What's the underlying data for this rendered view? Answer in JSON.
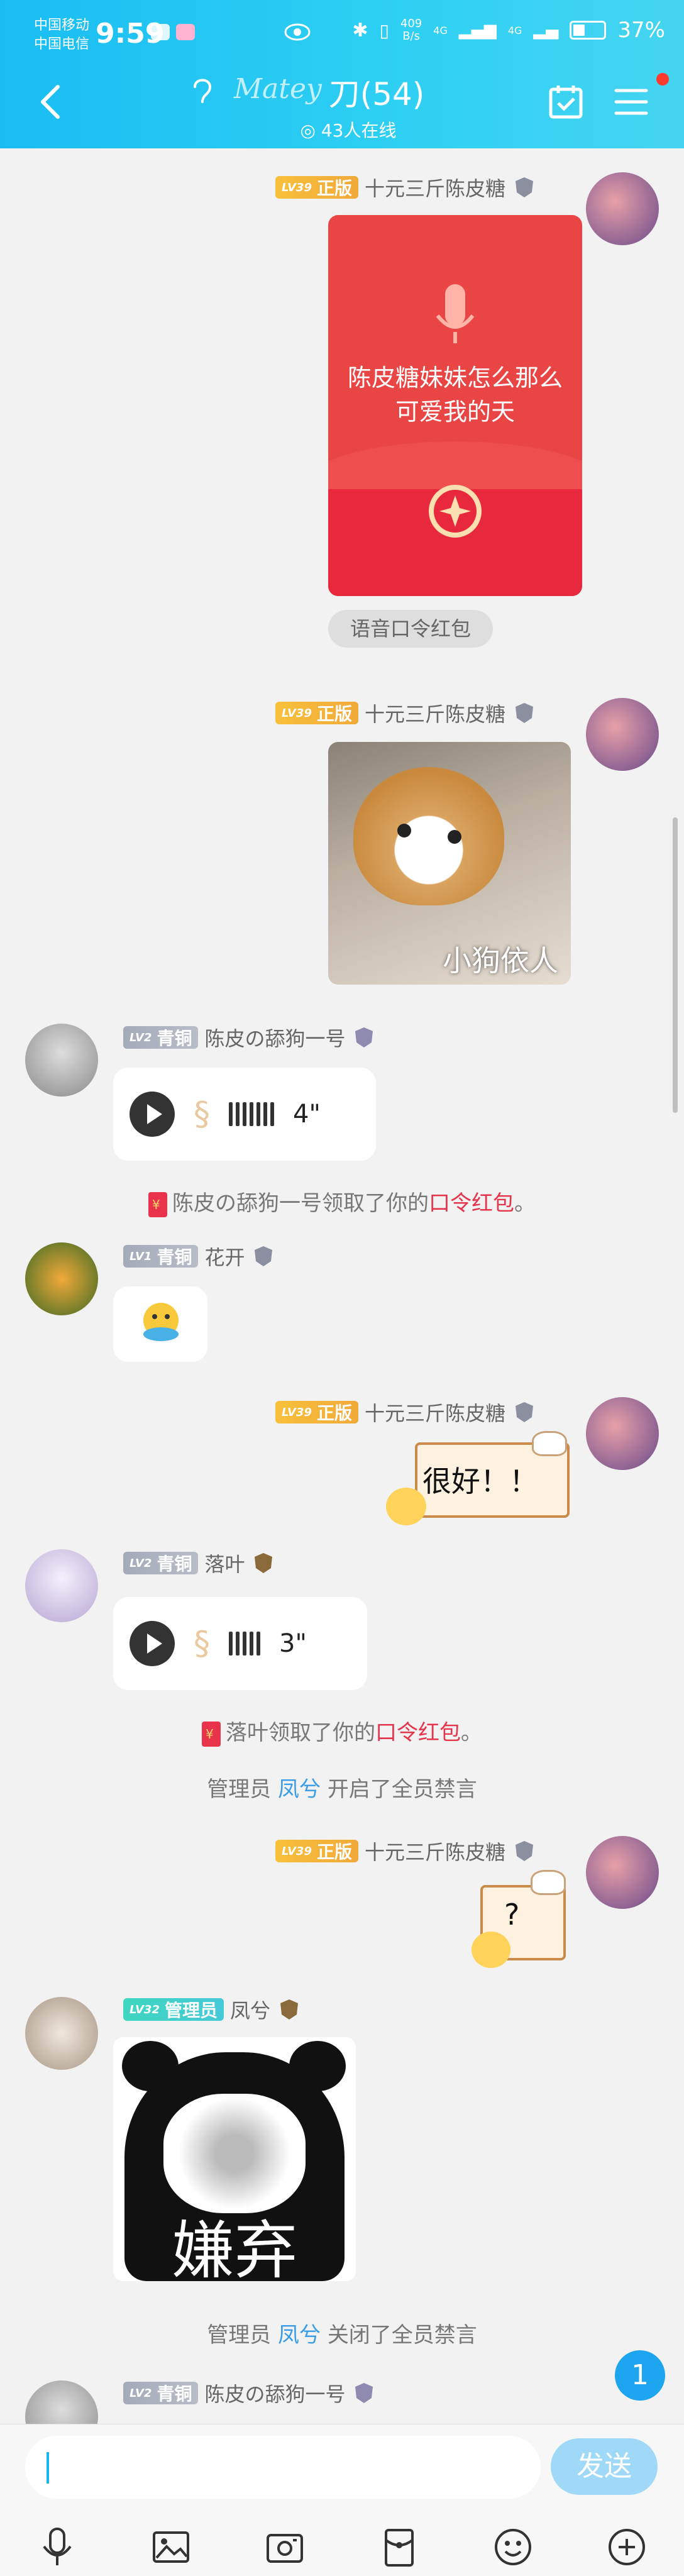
{
  "status_bar": {
    "carrier_1": "中国移动",
    "carrier_2": "中国电信",
    "time": "9:59",
    "speed_value": "409",
    "speed_unit": "B/s",
    "net_1": "4G",
    "net_2": "4G",
    "battery": "37%"
  },
  "header": {
    "title_badge": "Matey",
    "title": "刀(54)",
    "online": "43人在线"
  },
  "messages": {
    "m1": {
      "level": "LV39",
      "rank": "正版",
      "name": "十元三斤陈皮糖",
      "packet_text": "陈皮糖妹妹怎么那么可爱我的天",
      "packet_tag": "语音口令红包"
    },
    "m2": {
      "level": "LV39",
      "rank": "正版",
      "name": "十元三斤陈皮糖",
      "sticker_caption": "小狗依人"
    },
    "m3": {
      "level": "LV2",
      "rank": "青铜",
      "name": "陈皮の舔狗一号",
      "duration": "4\""
    },
    "sys1": {
      "actor": "陈皮の舔狗一号",
      "middle": "领取了你的",
      "packet": "口令红包",
      "end": "。"
    },
    "m4": {
      "level": "LV1",
      "rank": "青铜",
      "name": "花开"
    },
    "m5": {
      "level": "LV39",
      "rank": "正版",
      "name": "十元三斤陈皮糖",
      "sticker_text": "很好！！"
    },
    "m6": {
      "level": "LV2",
      "rank": "青铜",
      "name": "落叶",
      "duration": "3\""
    },
    "sys2": {
      "actor": "落叶",
      "middle": "领取了你的",
      "packet": "口令红包",
      "end": "。"
    },
    "sys3": {
      "prefix": "管理员",
      "admin": "凤兮",
      "action": "开启了全员禁言"
    },
    "m7": {
      "level": "LV39",
      "rank": "正版",
      "name": "十元三斤陈皮糖",
      "sticker_text": "?"
    },
    "m8": {
      "level": "LV32",
      "rank": "管理员",
      "name": "凤兮",
      "sticker_text": "嫌弃"
    },
    "sys4": {
      "prefix": "管理员",
      "admin": "凤兮",
      "action": "关闭了全员禁言"
    },
    "m9": {
      "level": "LV2",
      "rank": "青铜",
      "name": "陈皮の舔狗一号"
    }
  },
  "unread_count": "1",
  "input": {
    "value": "",
    "send_label": "发送"
  },
  "toolbar": [
    "mic-icon",
    "image-icon",
    "camera-icon",
    "red-packet-icon",
    "emoji-icon",
    "plus-icon"
  ],
  "colors": {
    "header": "#19bdf2",
    "accent_red": "#e5354d",
    "accent_blue": "#3a9ce6",
    "send": "#9fd9f7"
  }
}
